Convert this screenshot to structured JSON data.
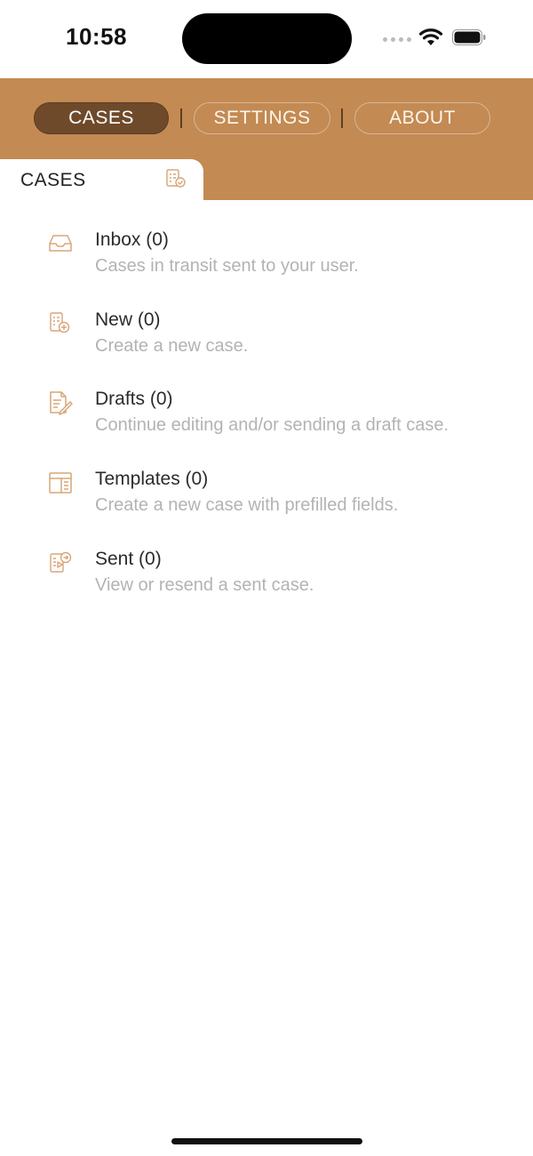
{
  "status_bar": {
    "time": "10:58"
  },
  "nav": {
    "cases_label": "CASES",
    "settings_label": "SETTINGS",
    "about_label": "ABOUT",
    "active": "CASES"
  },
  "tab": {
    "label": "CASES",
    "icon": "case-document-icon"
  },
  "items": [
    {
      "title": "Inbox (0)",
      "subtitle": "Cases in transit sent to your user.",
      "icon": "inbox-tray-icon"
    },
    {
      "title": "New (0)",
      "subtitle": "Create a new case.",
      "icon": "new-case-icon"
    },
    {
      "title": "Drafts (0)",
      "subtitle": "Continue editing and/or sending a draft case.",
      "icon": "draft-edit-icon"
    },
    {
      "title": "Templates (0)",
      "subtitle": "Create a new case with prefilled fields.",
      "icon": "template-layout-icon"
    },
    {
      "title": "Sent (0)",
      "subtitle": "View or resend a sent case.",
      "icon": "sent-case-icon"
    }
  ],
  "colors": {
    "header": "#c38a54",
    "active_button": "#6e4a2b",
    "icon_accent": "#d9a577",
    "subtitle": "#b3b3b3"
  }
}
